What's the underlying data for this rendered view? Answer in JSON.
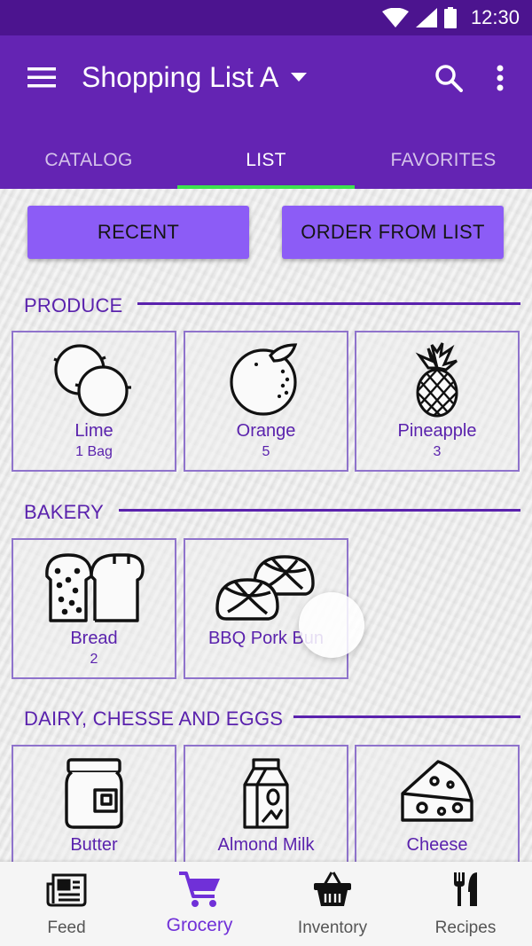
{
  "status_bar": {
    "time": "12:30"
  },
  "app_bar": {
    "title": "Shopping List A",
    "tabs": [
      {
        "label": "CATALOG",
        "active": false
      },
      {
        "label": "LIST",
        "active": true
      },
      {
        "label": "FAVORITES",
        "active": false
      }
    ]
  },
  "actions": {
    "recent_label": "RECENT",
    "order_label": "ORDER FROM LIST"
  },
  "sections": [
    {
      "title": "PRODUCE",
      "items": [
        {
          "name": "Lime",
          "quantity": "1 Bag",
          "icon": "lime-icon"
        },
        {
          "name": "Orange",
          "quantity": "5",
          "icon": "orange-icon"
        },
        {
          "name": "Pineapple",
          "quantity": "3",
          "icon": "pineapple-icon"
        }
      ]
    },
    {
      "title": "BAKERY",
      "items": [
        {
          "name": "Bread",
          "quantity": "2",
          "icon": "bread-icon"
        },
        {
          "name": "BBQ Pork Bun",
          "quantity": "",
          "icon": "buns-icon"
        }
      ]
    },
    {
      "title": "DAIRY, CHESSE AND EGGS",
      "items": [
        {
          "name": "Butter",
          "quantity": "",
          "icon": "butter-jar-icon"
        },
        {
          "name": "Almond Milk",
          "quantity": "",
          "icon": "milk-carton-icon"
        },
        {
          "name": "Cheese",
          "quantity": "",
          "icon": "cheese-icon"
        }
      ]
    }
  ],
  "bottom_nav": [
    {
      "label": "Feed",
      "icon": "newspaper-icon",
      "active": false
    },
    {
      "label": "Grocery",
      "icon": "shopping-cart-icon",
      "active": true
    },
    {
      "label": "Inventory",
      "icon": "basket-icon",
      "active": false
    },
    {
      "label": "Recipes",
      "icon": "fork-knife-icon",
      "active": false
    }
  ],
  "colors": {
    "primary": "#6424b3",
    "primary_dark": "#4c148f",
    "accent": "#8c5cf6",
    "tab_indicator": "#3de24e",
    "section_text": "#5a22ad"
  }
}
